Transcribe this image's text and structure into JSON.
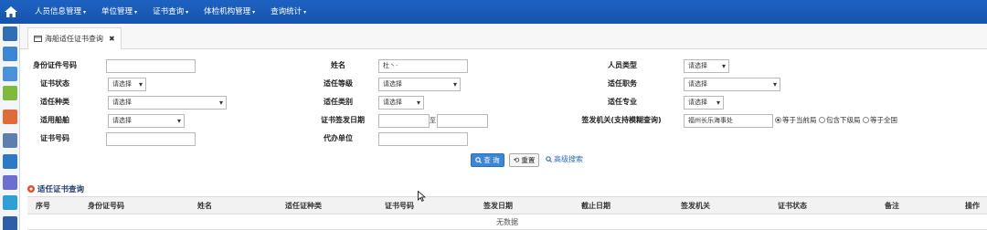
{
  "topnav": {
    "items": [
      {
        "label": "人员信息管理"
      },
      {
        "label": "单位管理"
      },
      {
        "label": "证书查询"
      },
      {
        "label": "体检机构管理"
      },
      {
        "label": "查询统计"
      }
    ]
  },
  "rail_icons": [
    "list-icon",
    "table-icon",
    "users-icon",
    "edit-icon",
    "card-icon",
    "archive-icon",
    "anchor-icon",
    "code-icon",
    "monitor-icon",
    "book-icon"
  ],
  "tab": {
    "label": "海船适任证书查询",
    "close": "✖"
  },
  "form": {
    "id_number_label": "身份证件号码",
    "id_number_value": "",
    "name_label": "姓名",
    "name_value": "杜丶·",
    "person_type_label": "人员类型",
    "person_type_value": "请选择",
    "cert_status_label": "证书状态",
    "cert_status_value": "请选择",
    "comp_level_label": "适任等级",
    "comp_level_value": "请选择",
    "comp_position_label": "适任职务",
    "comp_position_value": "请选择",
    "comp_type_label": "适任种类",
    "comp_type_value": "请选择",
    "comp_category_label": "适任类别",
    "comp_category_value": "请选择",
    "comp_major_label": "适任专业",
    "comp_major_value": "请选择",
    "vessel_label": "适用船舶",
    "vessel_value": "请选择",
    "issue_date_label": "证书签发日期",
    "issue_date_from": "",
    "issue_date_sep": "至",
    "issue_date_to": "",
    "authority_label": "签发机关(支持模糊查询)",
    "authority_value": "福州长乐海事处",
    "scope_options": [
      "等于当前局",
      "包含下级局",
      "等于全国"
    ],
    "cert_no_label": "证书号码",
    "cert_no_value": "",
    "agent_unit_label": "代办单位",
    "agent_unit_value": ""
  },
  "actions": {
    "search": "查 询",
    "reset": "重置",
    "advanced": "高级搜索"
  },
  "results": {
    "title": "适任证书查询",
    "columns": [
      "序号",
      "身份证号码",
      "姓名",
      "适任证种类",
      "证书号码",
      "签发日期",
      "截止日期",
      "签发机关",
      "证书状态",
      "备注",
      "操作"
    ],
    "empty_text": "无数据"
  },
  "colors": {
    "nav_bg": "#1d62c2",
    "primary": "#3d86d6",
    "link": "#2d6bb4"
  }
}
